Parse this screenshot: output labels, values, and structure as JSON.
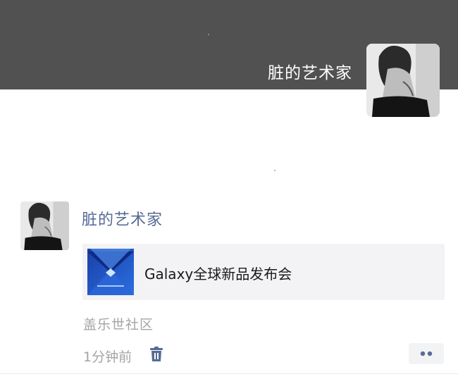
{
  "cover": {
    "user_name": "脏的艺术家",
    "background_color": "#515151"
  },
  "post": {
    "author": "脏的艺术家",
    "link": {
      "title": "Galaxy全球新品发布会",
      "thumbnail_icon": "galaxy-event-thumbnail"
    },
    "source": "盖乐世社区",
    "time": "1分钟前",
    "delete_icon": "trash-icon",
    "more_icon": "two-dots-icon"
  },
  "colors": {
    "author_link": "#576b95",
    "meta_text": "#a4a4a4",
    "card_background": "#f3f3f5"
  }
}
